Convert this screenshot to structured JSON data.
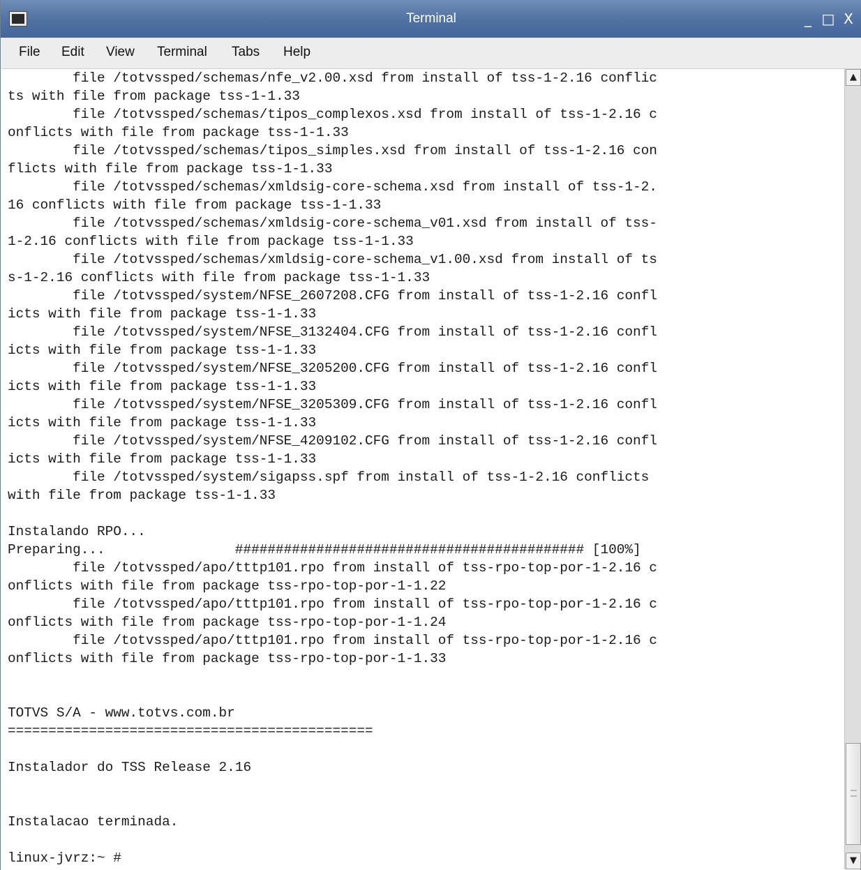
{
  "window": {
    "title": "Terminal",
    "controls": {
      "minimize": "_",
      "maximize": "□",
      "close": "X"
    }
  },
  "menu": {
    "items": [
      "File",
      "Edit",
      "View",
      "Terminal",
      "Tabs",
      "Help"
    ]
  },
  "terminal": {
    "lines": [
      "        file /totvssped/schemas/nfe_v2.00.xsd from install of tss-1-2.16 conflic",
      "ts with file from package tss-1-1.33",
      "        file /totvssped/schemas/tipos_complexos.xsd from install of tss-1-2.16 c",
      "onflicts with file from package tss-1-1.33",
      "        file /totvssped/schemas/tipos_simples.xsd from install of tss-1-2.16 con",
      "flicts with file from package tss-1-1.33",
      "        file /totvssped/schemas/xmldsig-core-schema.xsd from install of tss-1-2.",
      "16 conflicts with file from package tss-1-1.33",
      "        file /totvssped/schemas/xmldsig-core-schema_v01.xsd from install of tss-",
      "1-2.16 conflicts with file from package tss-1-1.33",
      "        file /totvssped/schemas/xmldsig-core-schema_v1.00.xsd from install of ts",
      "s-1-2.16 conflicts with file from package tss-1-1.33",
      "        file /totvssped/system/NFSE_2607208.CFG from install of tss-1-2.16 confl",
      "icts with file from package tss-1-1.33",
      "        file /totvssped/system/NFSE_3132404.CFG from install of tss-1-2.16 confl",
      "icts with file from package tss-1-1.33",
      "        file /totvssped/system/NFSE_3205200.CFG from install of tss-1-2.16 confl",
      "icts with file from package tss-1-1.33",
      "        file /totvssped/system/NFSE_3205309.CFG from install of tss-1-2.16 confl",
      "icts with file from package tss-1-1.33",
      "        file /totvssped/system/NFSE_4209102.CFG from install of tss-1-2.16 confl",
      "icts with file from package tss-1-1.33",
      "        file /totvssped/system/sigapss.spf from install of tss-1-2.16 conflicts",
      "with file from package tss-1-1.33",
      "",
      "Instalando RPO...",
      "Preparing...                ########################################### [100%]",
      "        file /totvssped/apo/tttp101.rpo from install of tss-rpo-top-por-1-2.16 c",
      "onflicts with file from package tss-rpo-top-por-1-1.22",
      "        file /totvssped/apo/tttp101.rpo from install of tss-rpo-top-por-1-2.16 c",
      "onflicts with file from package tss-rpo-top-por-1-1.24",
      "        file /totvssped/apo/tttp101.rpo from install of tss-rpo-top-por-1-2.16 c",
      "onflicts with file from package tss-rpo-top-por-1-1.33",
      "",
      "",
      "TOTVS S/A - www.totvs.com.br",
      "=============================================",
      "",
      "Instalador do TSS Release 2.16",
      "",
      "",
      "Instalacao terminada.",
      "",
      "linux-jvrz:~ #"
    ]
  },
  "scrollbar": {
    "up_arrow": "▲",
    "down_arrow": "▼",
    "position": 0.9
  }
}
